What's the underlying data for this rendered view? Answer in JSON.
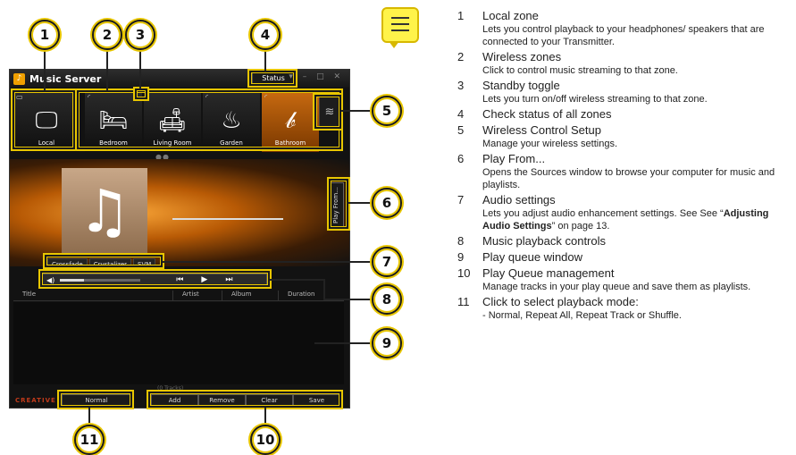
{
  "app": {
    "title": "Music Server",
    "status_label": "Status",
    "window_controls": "▾ – □ ✕"
  },
  "zones": [
    {
      "label": "Local",
      "glyph": "🖵"
    },
    {
      "label": "Bedroom",
      "glyph": "🛏"
    },
    {
      "label": "Living Room",
      "glyph": "🛋"
    },
    {
      "label": "Garden",
      "glyph": "♨"
    },
    {
      "label": "Bathroom",
      "glyph": "𝒷"
    }
  ],
  "nowplaying": {
    "cover_glyph": "♫",
    "play_from_label": "Play From..."
  },
  "audio_settings": [
    "Crossfade",
    "Crystalizer",
    "SVM"
  ],
  "transport": {
    "prev": "⏮",
    "play": "▶",
    "next": "⏭",
    "volume_icon": "◀)"
  },
  "volume_level": 0.3,
  "queue": {
    "columns": [
      "Title",
      "Artist",
      "Album",
      "Duration"
    ],
    "tracks_label": "(0 Tracks)"
  },
  "bottom": {
    "brand": "CREATIVE",
    "mode": "Normal",
    "buttons": [
      "Add",
      "Remove",
      "Clear",
      "Save"
    ]
  },
  "callouts": [
    "1",
    "2",
    "3",
    "4",
    "5",
    "6",
    "7",
    "8",
    "9",
    "10",
    "11"
  ],
  "legend": [
    {
      "num": "1",
      "title": "Local zone",
      "desc": "Lets you control playback to your headphones/ speakers that are connected to your Transmitter."
    },
    {
      "num": "2",
      "title": "Wireless zones",
      "desc": "Click to control music streaming to that zone."
    },
    {
      "num": "3",
      "title": "Standby toggle",
      "desc": "Lets you turn on/off wireless streaming to that zone."
    },
    {
      "num": "4",
      "title": "Check status of all zones",
      "desc": ""
    },
    {
      "num": "5",
      "title": "Wireless Control Setup",
      "desc": "Manage your wireless settings."
    },
    {
      "num": "6",
      "title": "Play From...",
      "desc": "Opens the Sources window to browse your computer for music and playlists."
    },
    {
      "num": "7",
      "title": "Audio settings",
      "desc_a": "Lets you adjust audio enhancement settings. See See “",
      "desc_bold": "Adjusting Audio Settings",
      "desc_b": "” on page 13."
    },
    {
      "num": "8",
      "title": "Music playback controls",
      "desc": ""
    },
    {
      "num": "9",
      "title": "Play queue window",
      "desc": ""
    },
    {
      "num": "10",
      "title": "Play Queue management",
      "desc": "Manage tracks in your play queue and save them as playlists."
    },
    {
      "num": "11",
      "title": "Click to select playback mode:",
      "desc": "- Normal, Repeat All, Repeat Track or Shuffle."
    }
  ]
}
